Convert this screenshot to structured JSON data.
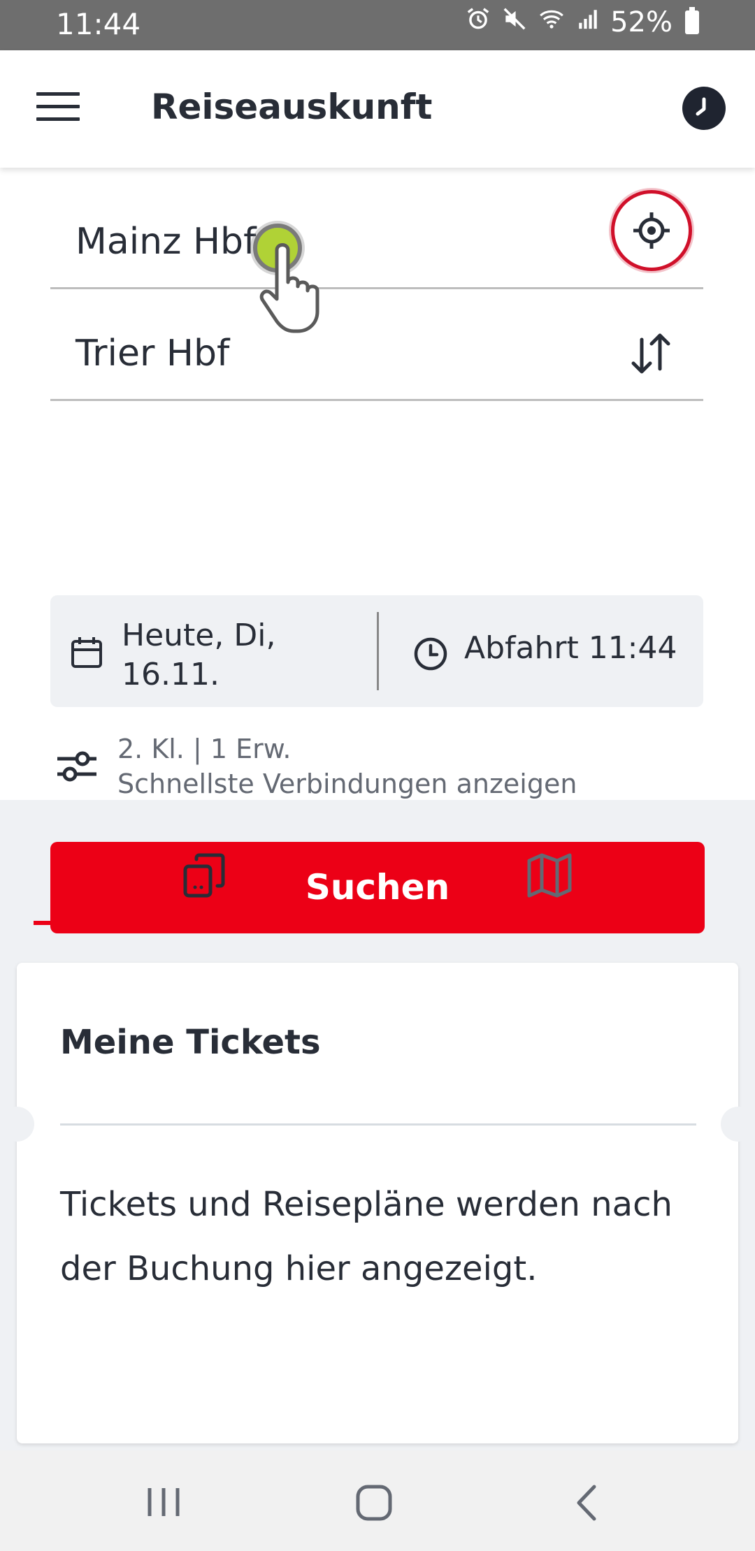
{
  "status_bar": {
    "time": "11:44",
    "battery": "52%"
  },
  "app_bar": {
    "title": "Reiseauskunft"
  },
  "search": {
    "from": "Mainz Hbf",
    "to": "Trier Hbf",
    "date_line1": "Heute, Di,",
    "date_line2": "16.11.",
    "time": "Abfahrt 11:44",
    "options_line1": "2. Kl. | 1 Erw.",
    "options_line2": "Schnellste Verbindungen anzeigen",
    "search_label": "Suchen"
  },
  "tabs": [
    {
      "icon": "tickets-icon",
      "active": true
    },
    {
      "icon": "map-icon",
      "active": false
    }
  ],
  "card": {
    "title": "Meine Tickets",
    "body": "Tickets und Reisepläne werden nach der Buchung hier angezeigt."
  },
  "colors": {
    "accent": "#ec0016",
    "text": "#282d37",
    "background": "#eff1f4"
  }
}
